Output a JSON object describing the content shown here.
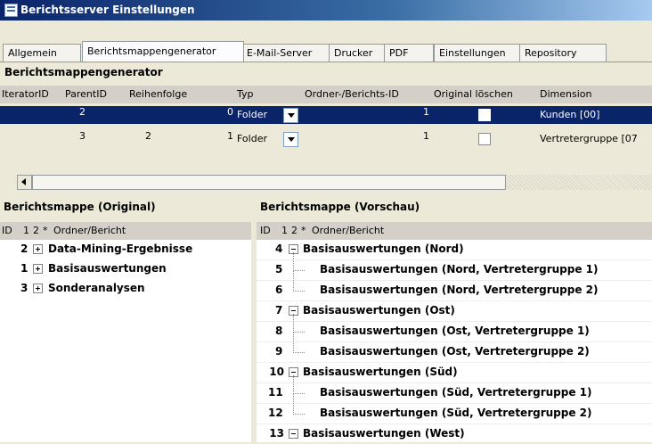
{
  "window": {
    "title": "Berichtsserver Einstellungen"
  },
  "tabs": [
    {
      "label": "Allgemein",
      "active": false
    },
    {
      "label": "Berichtsmappengenerator",
      "active": true
    },
    {
      "label": "E-Mail-Server",
      "active": false
    },
    {
      "label": "Drucker",
      "active": false
    },
    {
      "label": "PDF",
      "active": false
    },
    {
      "label": "Einstellungen",
      "active": false
    },
    {
      "label": "Repository",
      "active": false
    }
  ],
  "generator": {
    "section_title": "Berichtsmappengenerator",
    "columns": [
      "IteratorID",
      "ParentID",
      "Reihenfolge",
      "Typ",
      "Ordner-/Berichts-ID",
      "Original löschen",
      "Dimension"
    ],
    "rows": [
      {
        "iterator_id": "2",
        "parent_id": "",
        "reihenfolge": "0",
        "typ": "Folder",
        "ordner_id": "1",
        "original_loeschen": false,
        "dimension": "Kunden [00]",
        "selected": true
      },
      {
        "iterator_id": "3",
        "parent_id": "2",
        "reihenfolge": "1",
        "typ": "Folder",
        "ordner_id": "1",
        "original_loeschen": false,
        "dimension": "Vertretergruppe [07",
        "selected": false
      }
    ]
  },
  "original": {
    "title": "Berichtsmappe (Original)",
    "header": {
      "id": "ID",
      "c1": "1",
      "c2": "2",
      "star": "*",
      "name": "Ordner/Bericht"
    },
    "items": [
      {
        "id": "2",
        "label": "Data-Mining-Ergebnisse"
      },
      {
        "id": "1",
        "label": "Basisauswertungen"
      },
      {
        "id": "3",
        "label": "Sonderanalysen"
      }
    ]
  },
  "preview": {
    "title": "Berichtsmappe (Vorschau)",
    "header": {
      "id": "ID",
      "c1": "1",
      "c2": "2",
      "star": "*",
      "name": "Ordner/Bericht"
    },
    "items": [
      {
        "id": "4",
        "label": "Basisauswertungen (Nord)",
        "folder": true
      },
      {
        "id": "5",
        "label": "Basisauswertungen (Nord, Vertretergruppe 1)",
        "folder": false
      },
      {
        "id": "6",
        "label": "Basisauswertungen (Nord, Vertretergruppe 2)",
        "folder": false
      },
      {
        "id": "7",
        "label": "Basisauswertungen (Ost)",
        "folder": true
      },
      {
        "id": "8",
        "label": "Basisauswertungen (Ost, Vertretergruppe 1)",
        "folder": false
      },
      {
        "id": "9",
        "label": "Basisauswertungen (Ost, Vertretergruppe 2)",
        "folder": false
      },
      {
        "id": "10",
        "label": "Basisauswertungen (Süd)",
        "folder": true
      },
      {
        "id": "11",
        "label": "Basisauswertungen (Süd, Vertretergruppe 1)",
        "folder": false
      },
      {
        "id": "12",
        "label": "Basisauswertungen (Süd, Vertretergruppe 2)",
        "folder": false
      },
      {
        "id": "13",
        "label": "Basisauswertungen (West)",
        "folder": true
      }
    ]
  },
  "colors": {
    "selection": "#0a246a",
    "title_bar": "#0a246a",
    "window_bg": "#ece9d8"
  }
}
